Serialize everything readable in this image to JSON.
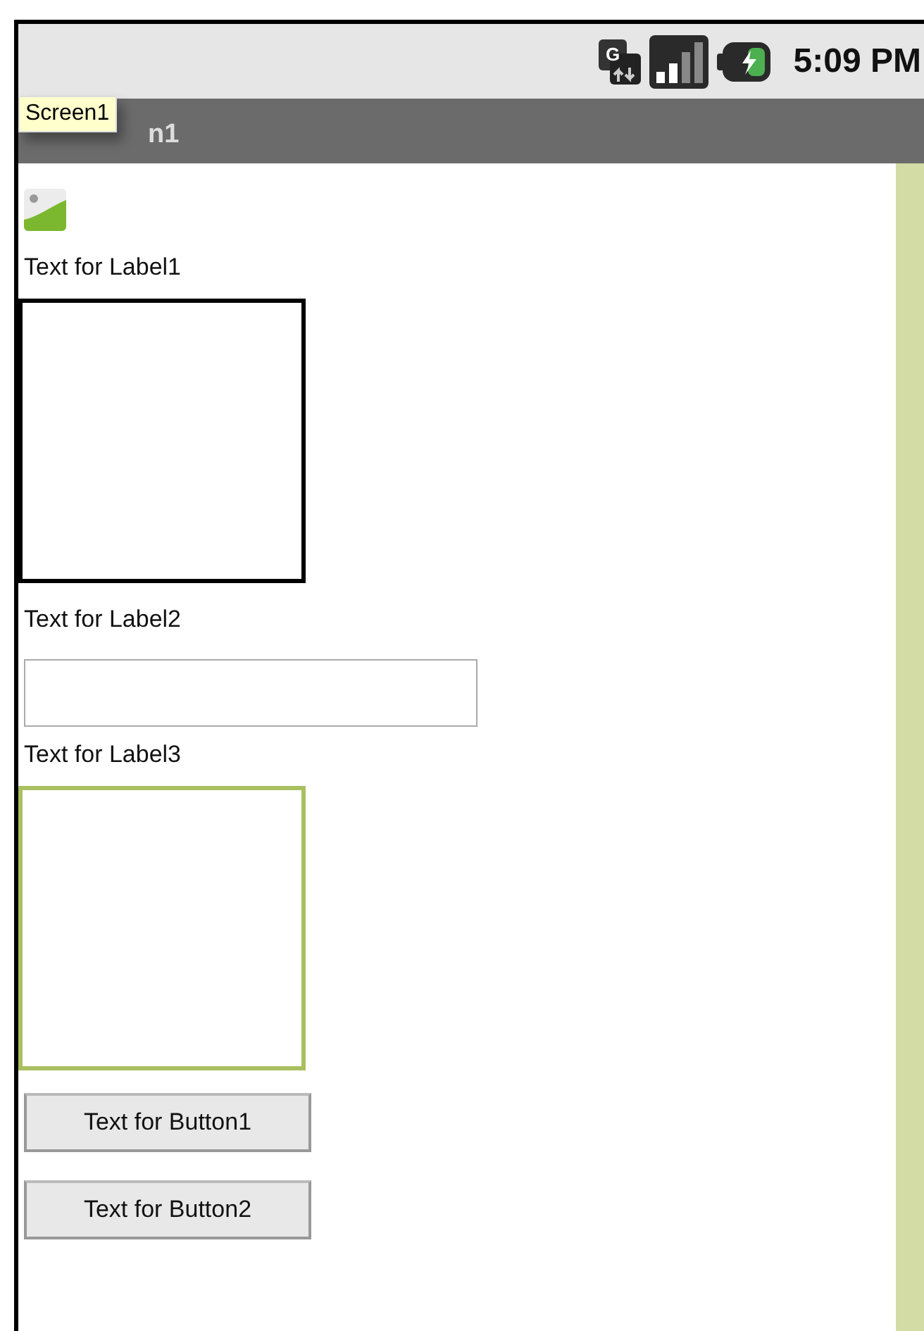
{
  "status_bar": {
    "network": "G",
    "time": "5:09 PM"
  },
  "title_bar": {
    "title": "n1",
    "tooltip": "Screen1"
  },
  "components": [
    {
      "kind": "image"
    },
    {
      "kind": "label",
      "text": "Text for Label1"
    },
    {
      "kind": "canvas",
      "selected": false
    },
    {
      "kind": "label",
      "text": "Text for Label2"
    },
    {
      "kind": "textbox"
    },
    {
      "kind": "label",
      "text": "Text for Label3"
    },
    {
      "kind": "canvas",
      "selected": true
    },
    {
      "kind": "button",
      "text": "Text for Button1"
    },
    {
      "kind": "button",
      "text": "Text for Button2"
    }
  ]
}
